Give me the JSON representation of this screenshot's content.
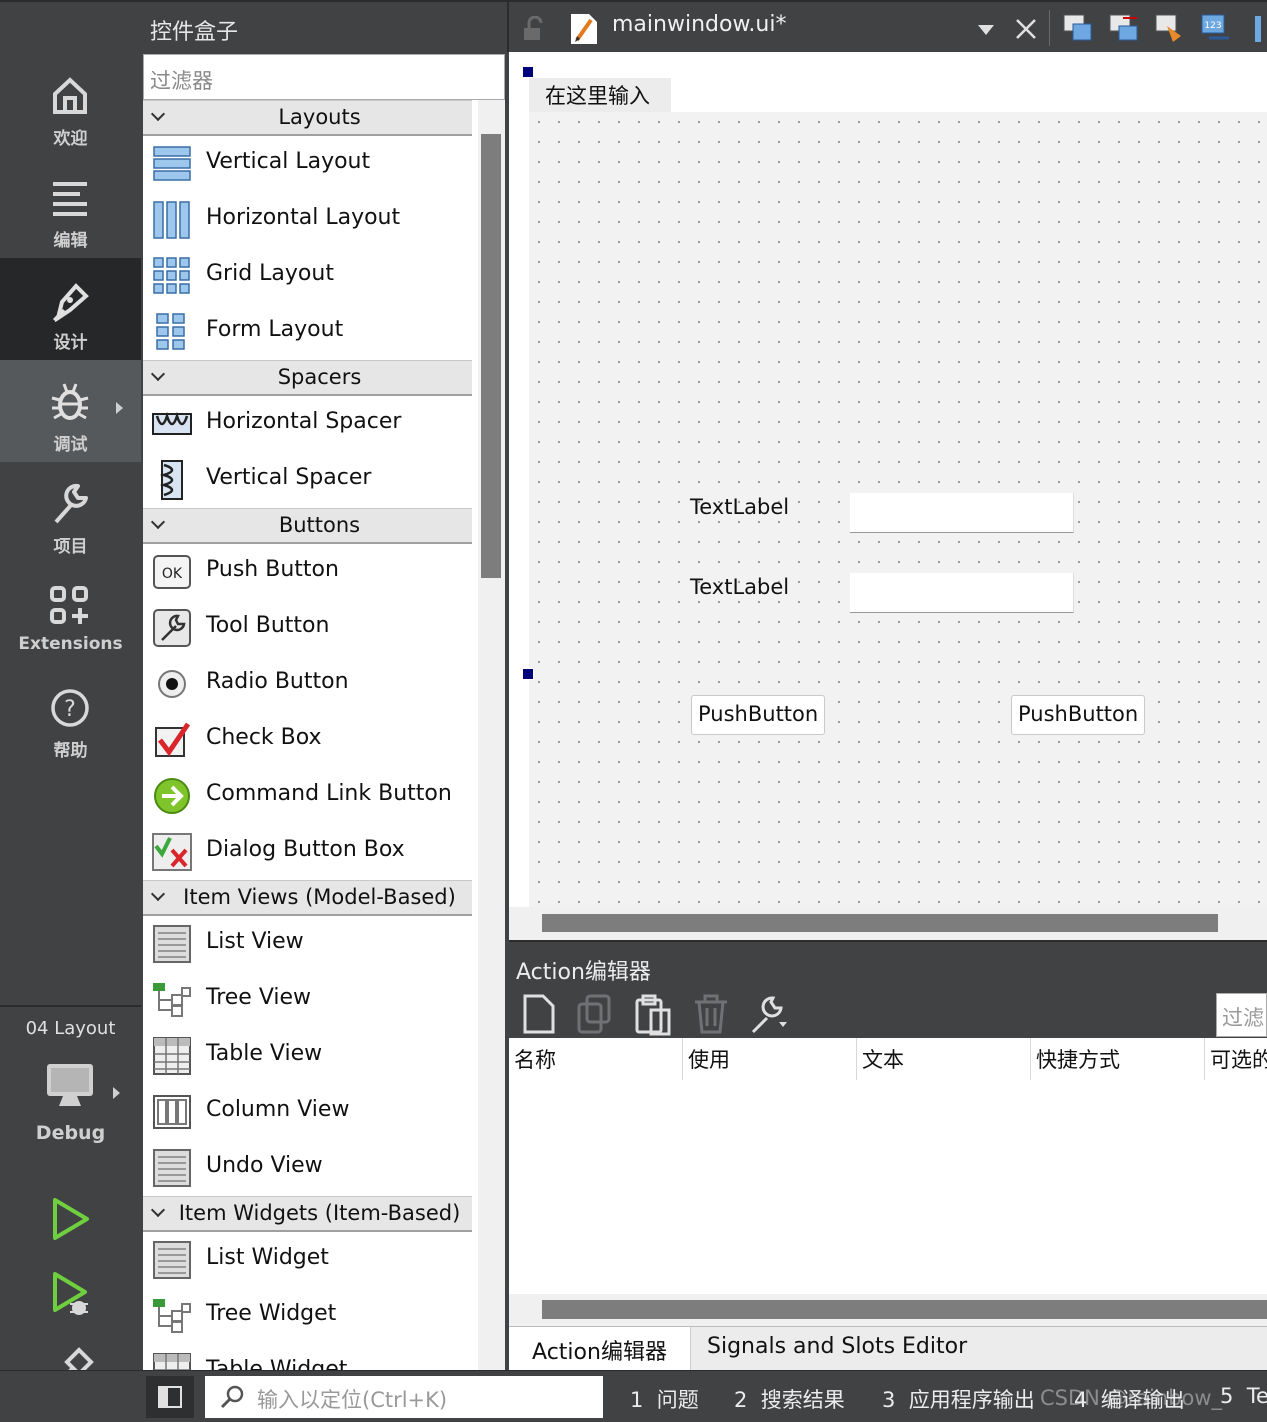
{
  "modes": [
    {
      "label": "欢迎",
      "icon": "home-icon"
    },
    {
      "label": "编辑",
      "icon": "edit-lines-icon"
    },
    {
      "label": "设计",
      "icon": "design-pen-icon"
    },
    {
      "label": "调试",
      "icon": "bug-icon"
    },
    {
      "label": "项目",
      "icon": "wrench-icon"
    },
    {
      "label": "Extensions",
      "icon": "extensions-icon"
    },
    {
      "label": "帮助",
      "icon": "help-icon"
    }
  ],
  "kit": {
    "project": "04 Layout",
    "build_config": "Debug"
  },
  "widget_box": {
    "title": "控件盒子",
    "filter_placeholder": "过滤器",
    "categories": [
      {
        "name": "Layouts",
        "items": [
          "Vertical Layout",
          "Horizontal Layout",
          "Grid Layout",
          "Form Layout"
        ]
      },
      {
        "name": "Spacers",
        "items": [
          "Horizontal Spacer",
          "Vertical Spacer"
        ]
      },
      {
        "name": "Buttons",
        "items": [
          "Push Button",
          "Tool Button",
          "Radio Button",
          "Check Box",
          "Command Link Button",
          "Dialog Button Box"
        ]
      },
      {
        "name": "Item Views (Model-Based)",
        "items": [
          "List View",
          "Tree View",
          "Table View",
          "Column View",
          "Undo View"
        ]
      },
      {
        "name": "Item Widgets (Item-Based)",
        "items": [
          "List Widget",
          "Tree Widget",
          "Table Widget"
        ]
      }
    ]
  },
  "editor": {
    "document_title": "mainwindow.ui*",
    "menu_placeholder": "在这里输入",
    "form": {
      "label1": "TextLabel",
      "label2": "TextLabel",
      "button1": "PushButton",
      "button2": "PushButton"
    }
  },
  "action_editor": {
    "title": "Action编辑器",
    "filter_placeholder": "过滤",
    "columns": [
      "名称",
      "使用",
      "文本",
      "快捷方式",
      "可选的"
    ],
    "tabs": [
      "Action编辑器",
      "Signals and Slots Editor"
    ]
  },
  "status_bar": {
    "locator_placeholder": "输入以定位(Ctrl+K)",
    "tabs": [
      {
        "num": "1",
        "label": "问题"
      },
      {
        "num": "2",
        "label": "搜索结果"
      },
      {
        "num": "3",
        "label": "应用程序输出"
      },
      {
        "num": "4",
        "label": "编译输出"
      },
      {
        "num": "5",
        "label": "Te"
      }
    ],
    "watermark": "CSDN @rainbow_"
  },
  "colors": {
    "sidebar": "#404244",
    "active_mode": "#262728",
    "selection_handle": "#00007a"
  }
}
